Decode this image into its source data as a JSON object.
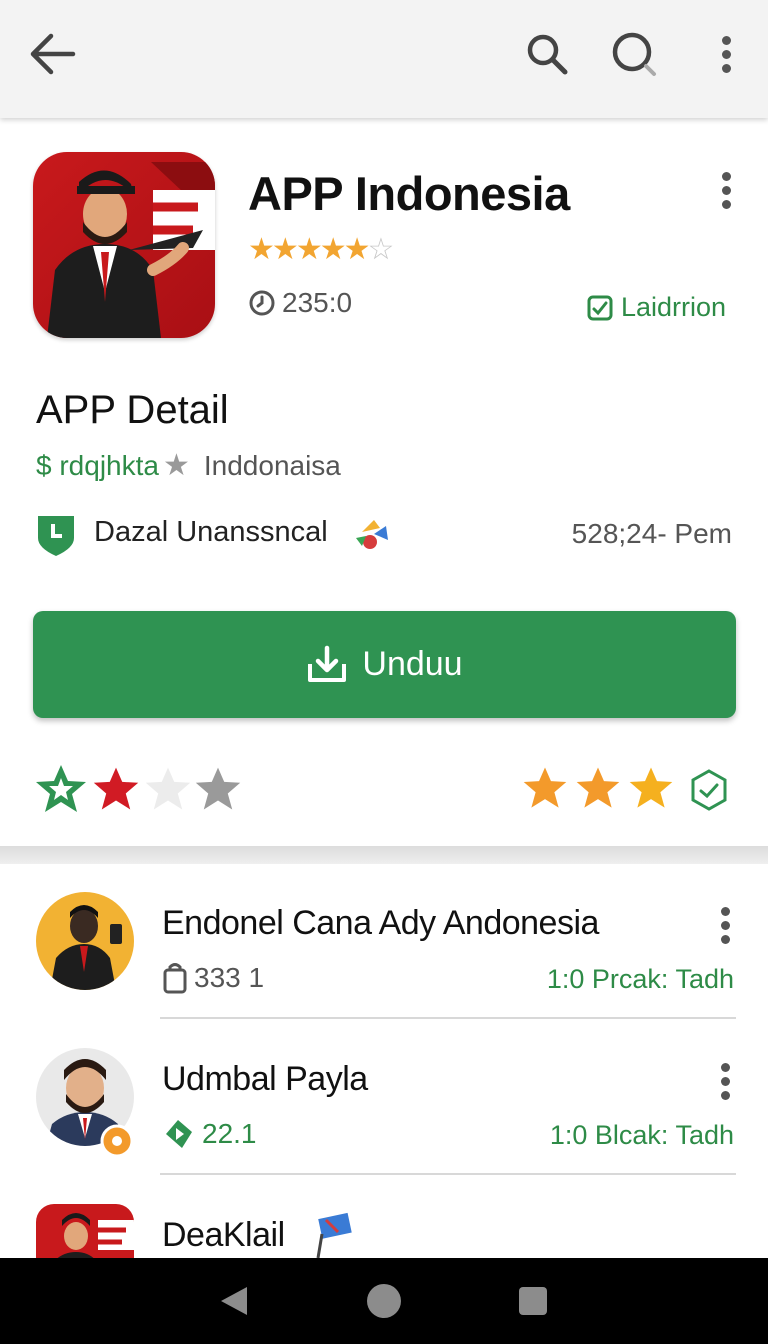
{
  "colors": {
    "accent": "#2f9352",
    "appbar": "#f3f3f3",
    "star": "#f2a531",
    "brand_red": "#c8191c"
  },
  "app": {
    "title": "APP Indonesia",
    "rating_stars": "4.5",
    "downloads": "235:0",
    "badge": "Laidrrion"
  },
  "detail": {
    "heading": "APP Detail",
    "price_text": "$ rdqjhkta",
    "region": "Inddonaisa",
    "developer": "Dazal Unanssncal",
    "timestamp": "528;24- Pem"
  },
  "install": {
    "label": "Unduu"
  },
  "list": [
    {
      "name": "Endonel Cana Ady Andonesia",
      "count": "333 1",
      "status": "1:0 Prcak: Tadh"
    },
    {
      "name": "Udmbal Payla",
      "count": "22.1",
      "status": "1:0 Blcak: Tadh"
    },
    {
      "name": "DeaKlail"
    }
  ]
}
